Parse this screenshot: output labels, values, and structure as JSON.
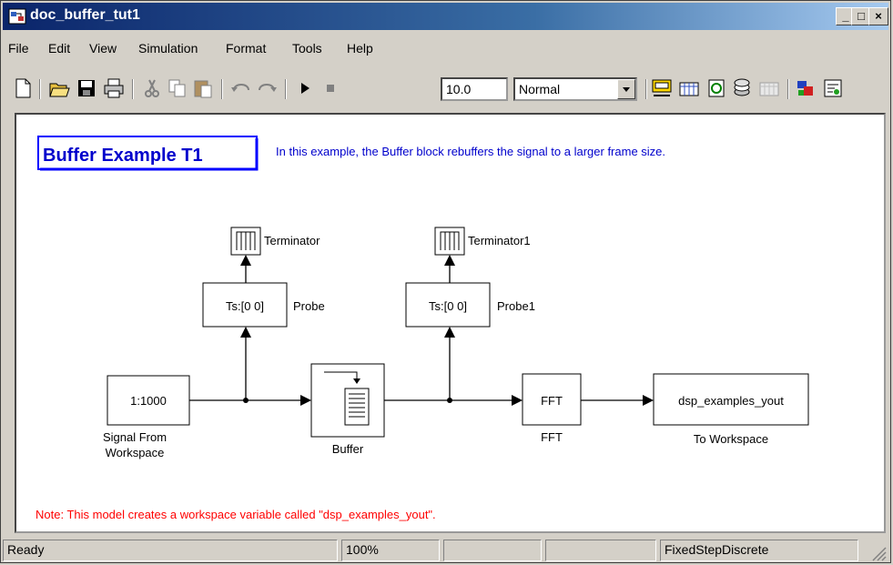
{
  "window": {
    "title": "doc_buffer_tut1",
    "min": "_",
    "max": "□",
    "close": "×"
  },
  "menu": [
    "File",
    "Edit",
    "View",
    "Simulation",
    "Format",
    "Tools",
    "Help"
  ],
  "toolbar": {
    "stop_time": "10.0",
    "sim_mode": "Normal",
    "icons": [
      "new-icon",
      "open-icon",
      "save-icon",
      "print-icon",
      "cut-icon",
      "copy-icon",
      "paste-icon",
      "undo-icon",
      "redo-icon",
      "play-icon",
      "stop-icon",
      "build-icon",
      "library-icon",
      "refresh-icon",
      "debug-icon",
      "profile-icon",
      "model-explorer-icon",
      "diagnostics-icon"
    ]
  },
  "model": {
    "title": "Buffer Example T1",
    "description": "In this example, the Buffer block rebuffers the signal to a larger frame size.",
    "note": "Note: This model creates a workspace variable called \"dsp_examples_yout\".",
    "blocks": {
      "source": {
        "text": "1:1000",
        "label1": "Signal From",
        "label2": "Workspace"
      },
      "buffer": {
        "label": "Buffer"
      },
      "fft": {
        "text": "FFT",
        "label": "FFT"
      },
      "workspace": {
        "text": "dsp_examples_yout",
        "label": "To Workspace"
      },
      "probe": {
        "text": "Ts:[0 0]",
        "label": "Probe"
      },
      "probe1": {
        "text": "Ts:[0 0]",
        "label": "Probe1"
      },
      "terminator": {
        "label": "Terminator"
      },
      "terminator1": {
        "label": "Terminator1"
      }
    },
    "colors": {
      "title_border": "#0000ff",
      "title_text": "#0000cc",
      "description": "#0000cc",
      "note": "#ff0000"
    }
  },
  "status": {
    "ready": "Ready",
    "zoom": "100%",
    "cell3": "",
    "cell4": "",
    "solver": "FixedStepDiscrete"
  }
}
